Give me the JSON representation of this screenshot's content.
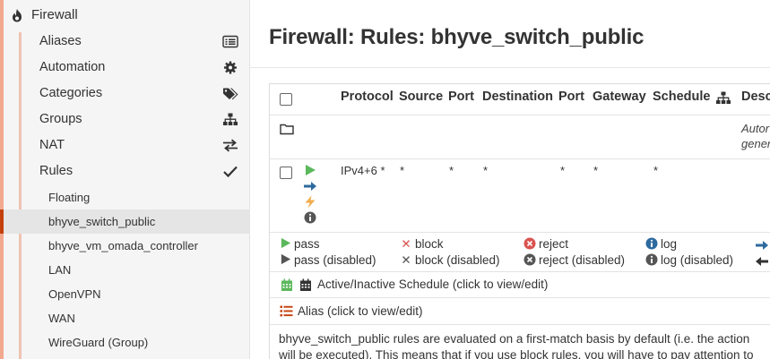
{
  "sidebar": {
    "section_label": "Firewall",
    "items": [
      {
        "label": "Aliases"
      },
      {
        "label": "Automation"
      },
      {
        "label": "Categories"
      },
      {
        "label": "Groups"
      },
      {
        "label": "NAT"
      },
      {
        "label": "Rules"
      }
    ],
    "sub_items": [
      {
        "label": "Floating"
      },
      {
        "label": "bhyve_switch_public"
      },
      {
        "label": "bhyve_vm_omada_controller"
      },
      {
        "label": "LAN"
      },
      {
        "label": "OpenVPN"
      },
      {
        "label": "WAN"
      },
      {
        "label": "WireGuard (Group)"
      }
    ]
  },
  "main": {
    "title": "Firewall: Rules: bhyve_switch_public",
    "table": {
      "columns": [
        "Protocol",
        "Source",
        "Port",
        "Destination",
        "Port",
        "Gateway",
        "Schedule",
        "Descr"
      ],
      "folder_row_description": [
        "Autor",
        "gener"
      ],
      "rule": {
        "protocol": "IPv4+6 *",
        "source": "*",
        "source_port": "*",
        "destination": "*",
        "destination_port": "*",
        "gateway": "*",
        "schedule": "*"
      }
    },
    "legend": {
      "pass": "pass",
      "block": "block",
      "reject": "reject",
      "log": "log",
      "pass_disabled": "pass (disabled)",
      "block_disabled": "block (disabled)",
      "reject_disabled": "reject (disabled)",
      "log_disabled": "log (disabled)"
    },
    "schedule_legend": "Active/Inactive Schedule (click to view/edit)",
    "alias_legend": "Alias (click to view/edit)",
    "info_line1": "bhyve_switch_public rules are evaluated on a first-match basis by default (i.e. the action",
    "info_line2": "will be executed). This means that if you use block rules, you will have to pay attention to"
  },
  "colors": {
    "accent": "#c4410c",
    "sidebar_stripe": "#f3a98f",
    "pass_green": "#5cb85c",
    "info_blue": "#2d6a9f",
    "reject_red": "#d9534f",
    "flash_orange": "#f0ad4e"
  },
  "icons": {
    "firewall": "fire-icon",
    "aliases": "list-icon",
    "automation": "gear-icon",
    "categories": "tags-icon",
    "groups": "sitemap-icon",
    "nat": "exchange-icon",
    "rules": "check-icon"
  }
}
